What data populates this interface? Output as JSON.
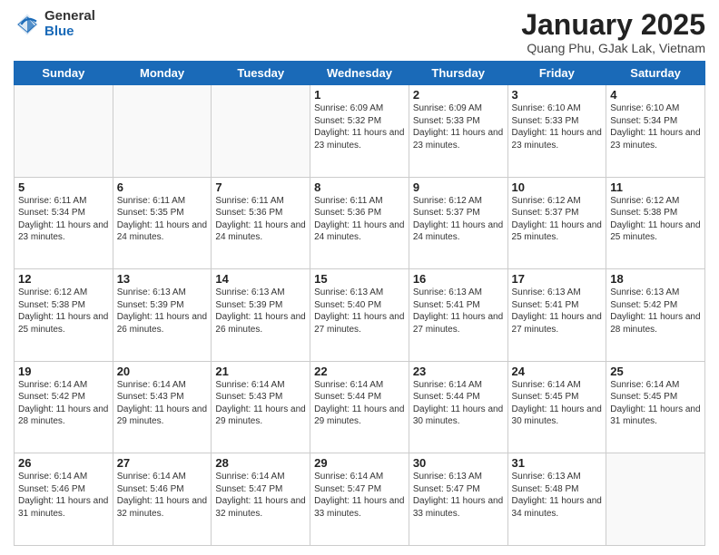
{
  "logo": {
    "general": "General",
    "blue": "Blue"
  },
  "header": {
    "title": "January 2025",
    "location": "Quang Phu, GJak Lak, Vietnam"
  },
  "days_of_week": [
    "Sunday",
    "Monday",
    "Tuesday",
    "Wednesday",
    "Thursday",
    "Friday",
    "Saturday"
  ],
  "weeks": [
    [
      {
        "num": "",
        "info": ""
      },
      {
        "num": "",
        "info": ""
      },
      {
        "num": "",
        "info": ""
      },
      {
        "num": "1",
        "info": "Sunrise: 6:09 AM\nSunset: 5:32 PM\nDaylight: 11 hours and 23 minutes."
      },
      {
        "num": "2",
        "info": "Sunrise: 6:09 AM\nSunset: 5:33 PM\nDaylight: 11 hours and 23 minutes."
      },
      {
        "num": "3",
        "info": "Sunrise: 6:10 AM\nSunset: 5:33 PM\nDaylight: 11 hours and 23 minutes."
      },
      {
        "num": "4",
        "info": "Sunrise: 6:10 AM\nSunset: 5:34 PM\nDaylight: 11 hours and 23 minutes."
      }
    ],
    [
      {
        "num": "5",
        "info": "Sunrise: 6:11 AM\nSunset: 5:34 PM\nDaylight: 11 hours and 23 minutes."
      },
      {
        "num": "6",
        "info": "Sunrise: 6:11 AM\nSunset: 5:35 PM\nDaylight: 11 hours and 24 minutes."
      },
      {
        "num": "7",
        "info": "Sunrise: 6:11 AM\nSunset: 5:36 PM\nDaylight: 11 hours and 24 minutes."
      },
      {
        "num": "8",
        "info": "Sunrise: 6:11 AM\nSunset: 5:36 PM\nDaylight: 11 hours and 24 minutes."
      },
      {
        "num": "9",
        "info": "Sunrise: 6:12 AM\nSunset: 5:37 PM\nDaylight: 11 hours and 24 minutes."
      },
      {
        "num": "10",
        "info": "Sunrise: 6:12 AM\nSunset: 5:37 PM\nDaylight: 11 hours and 25 minutes."
      },
      {
        "num": "11",
        "info": "Sunrise: 6:12 AM\nSunset: 5:38 PM\nDaylight: 11 hours and 25 minutes."
      }
    ],
    [
      {
        "num": "12",
        "info": "Sunrise: 6:12 AM\nSunset: 5:38 PM\nDaylight: 11 hours and 25 minutes."
      },
      {
        "num": "13",
        "info": "Sunrise: 6:13 AM\nSunset: 5:39 PM\nDaylight: 11 hours and 26 minutes."
      },
      {
        "num": "14",
        "info": "Sunrise: 6:13 AM\nSunset: 5:39 PM\nDaylight: 11 hours and 26 minutes."
      },
      {
        "num": "15",
        "info": "Sunrise: 6:13 AM\nSunset: 5:40 PM\nDaylight: 11 hours and 27 minutes."
      },
      {
        "num": "16",
        "info": "Sunrise: 6:13 AM\nSunset: 5:41 PM\nDaylight: 11 hours and 27 minutes."
      },
      {
        "num": "17",
        "info": "Sunrise: 6:13 AM\nSunset: 5:41 PM\nDaylight: 11 hours and 27 minutes."
      },
      {
        "num": "18",
        "info": "Sunrise: 6:13 AM\nSunset: 5:42 PM\nDaylight: 11 hours and 28 minutes."
      }
    ],
    [
      {
        "num": "19",
        "info": "Sunrise: 6:14 AM\nSunset: 5:42 PM\nDaylight: 11 hours and 28 minutes."
      },
      {
        "num": "20",
        "info": "Sunrise: 6:14 AM\nSunset: 5:43 PM\nDaylight: 11 hours and 29 minutes."
      },
      {
        "num": "21",
        "info": "Sunrise: 6:14 AM\nSunset: 5:43 PM\nDaylight: 11 hours and 29 minutes."
      },
      {
        "num": "22",
        "info": "Sunrise: 6:14 AM\nSunset: 5:44 PM\nDaylight: 11 hours and 29 minutes."
      },
      {
        "num": "23",
        "info": "Sunrise: 6:14 AM\nSunset: 5:44 PM\nDaylight: 11 hours and 30 minutes."
      },
      {
        "num": "24",
        "info": "Sunrise: 6:14 AM\nSunset: 5:45 PM\nDaylight: 11 hours and 30 minutes."
      },
      {
        "num": "25",
        "info": "Sunrise: 6:14 AM\nSunset: 5:45 PM\nDaylight: 11 hours and 31 minutes."
      }
    ],
    [
      {
        "num": "26",
        "info": "Sunrise: 6:14 AM\nSunset: 5:46 PM\nDaylight: 11 hours and 31 minutes."
      },
      {
        "num": "27",
        "info": "Sunrise: 6:14 AM\nSunset: 5:46 PM\nDaylight: 11 hours and 32 minutes."
      },
      {
        "num": "28",
        "info": "Sunrise: 6:14 AM\nSunset: 5:47 PM\nDaylight: 11 hours and 32 minutes."
      },
      {
        "num": "29",
        "info": "Sunrise: 6:14 AM\nSunset: 5:47 PM\nDaylight: 11 hours and 33 minutes."
      },
      {
        "num": "30",
        "info": "Sunrise: 6:13 AM\nSunset: 5:47 PM\nDaylight: 11 hours and 33 minutes."
      },
      {
        "num": "31",
        "info": "Sunrise: 6:13 AM\nSunset: 5:48 PM\nDaylight: 11 hours and 34 minutes."
      },
      {
        "num": "",
        "info": ""
      }
    ]
  ]
}
